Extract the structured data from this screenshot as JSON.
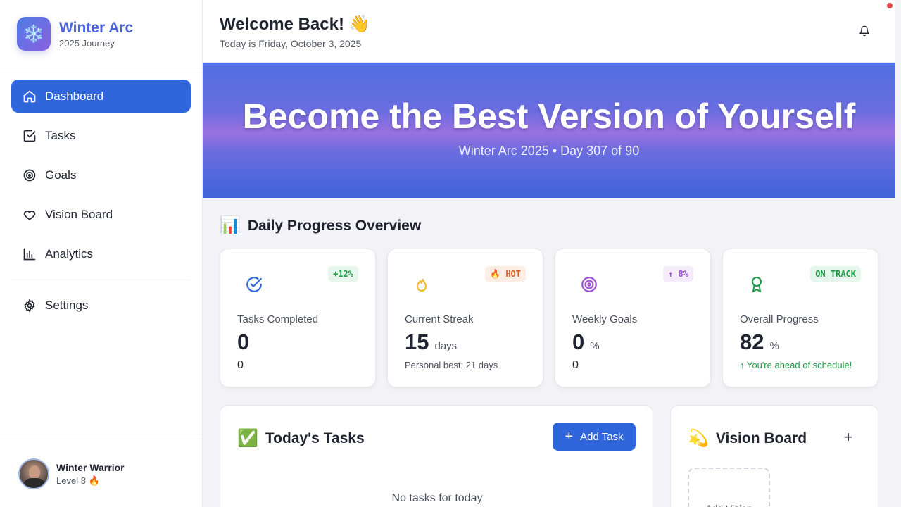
{
  "brand": {
    "title": "Winter Arc",
    "subtitle": "2025 Journey",
    "logo_glyph": "❄️"
  },
  "sidebar": {
    "items": [
      {
        "label": "Dashboard",
        "icon": "home-icon",
        "active": true
      },
      {
        "label": "Tasks",
        "icon": "checkbox-icon",
        "active": false
      },
      {
        "label": "Goals",
        "icon": "target-icon",
        "active": false
      },
      {
        "label": "Vision Board",
        "icon": "heart-icon",
        "active": false
      },
      {
        "label": "Analytics",
        "icon": "bar-chart-icon",
        "active": false
      }
    ],
    "settings": {
      "label": "Settings",
      "icon": "gear-icon"
    }
  },
  "profile": {
    "name": "Winter Warrior",
    "level": "Level 8 🔥"
  },
  "header": {
    "welcome": "Welcome Back! 👋",
    "date": "Today is Friday, October 3, 2025"
  },
  "hero": {
    "title": "Become the Best Version of Yourself",
    "subtitle": "Winter Arc 2025 • Day 307 of 90"
  },
  "overview": {
    "title": "Daily Progress Overview",
    "emoji": "📊",
    "cards": [
      {
        "label": "Tasks Completed",
        "value": "0",
        "unit": "",
        "foot": "0",
        "badge": "+12%",
        "badge_bg": "#e7f6ec",
        "badge_color": "#1f9a45",
        "icon": "check-circle-icon"
      },
      {
        "label": "Current Streak",
        "value": "15",
        "unit": "days",
        "foot": "Personal best: 21 days",
        "badge": "🔥 HOT",
        "badge_bg": "#fdeee5",
        "badge_color": "#e0602a",
        "icon": "flame-icon"
      },
      {
        "label": "Weekly Goals",
        "value": "0",
        "unit": "%",
        "foot": "0",
        "badge": "↑ 8%",
        "badge_bg": "#f4ecfb",
        "badge_color": "#9b4fd4",
        "icon": "target-icon"
      },
      {
        "label": "Overall Progress",
        "value": "82",
        "unit": "%",
        "foot": "↑ You're ahead of schedule!",
        "badge": "ON TRACK",
        "badge_bg": "#e7f6ec",
        "badge_color": "#1f9a45",
        "icon": "award-icon"
      }
    ]
  },
  "tasks": {
    "title": "Today's Tasks",
    "emoji": "✅",
    "add_label": "Add Task",
    "empty": "No tasks for today"
  },
  "vision": {
    "title": "Vision Board",
    "emoji": "💫",
    "add_label": "Add Vision"
  }
}
